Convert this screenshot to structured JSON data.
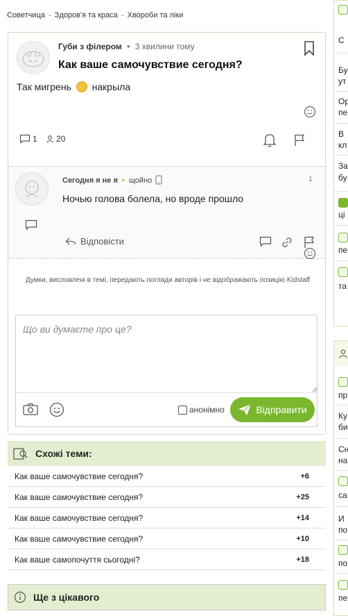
{
  "breadcrumb": [
    "Советчица",
    "Здоров'я та краса",
    "Хвороби та ліки"
  ],
  "post": {
    "author": "Губи з філером",
    "time": "3 хвилини тому",
    "title": "Как ваше самочувствие сегодня?",
    "body_before": "Так мигрень",
    "body_after": "накрыла",
    "comment_count": "1",
    "views_count": "20"
  },
  "comment": {
    "author": "Сегодня я не я",
    "online_dot": "•",
    "time": "щойно",
    "number": "1",
    "text": "Ночью голова болела, но вроде прошло",
    "reply_label": "Відповісти"
  },
  "disclaimer": "Думки, висловлені в темі, передають погляди авторів і не відображають позицію Kidstaff",
  "reply_form": {
    "placeholder": "Що ви думаєте про це?",
    "anon_label": "анонімно",
    "send_label": "Відправити"
  },
  "similar": {
    "title": "Схожі теми:",
    "items": [
      {
        "title": "Как ваше самочувствие сегодня?",
        "count": "+6"
      },
      {
        "title": "Как ваше самочувствие сегодня?",
        "count": "+25"
      },
      {
        "title": "Как ваше самочувствие сегодня?",
        "count": "+14"
      },
      {
        "title": "Как ваше самочувствие сегодня?",
        "count": "+10"
      },
      {
        "title": "Как ваше самопочуття сьогодні?",
        "count": "+18"
      }
    ]
  },
  "more": {
    "title": "Ще з цікавого"
  },
  "sidebar": {
    "top_items": [
      "С",
      "Бу",
      "ут",
      "Ор",
      "пе",
      "В",
      "кл",
      "За",
      "бу",
      "ці",
      "пе",
      "та"
    ],
    "second_items": [
      "пр",
      "Ку",
      "би",
      "Сн",
      "на",
      "са",
      "И",
      "по",
      "по",
      "пе"
    ]
  },
  "colors": {
    "accent": "#7ab72f",
    "section_bg": "#e3eed0",
    "border": "#cfd8bf"
  }
}
